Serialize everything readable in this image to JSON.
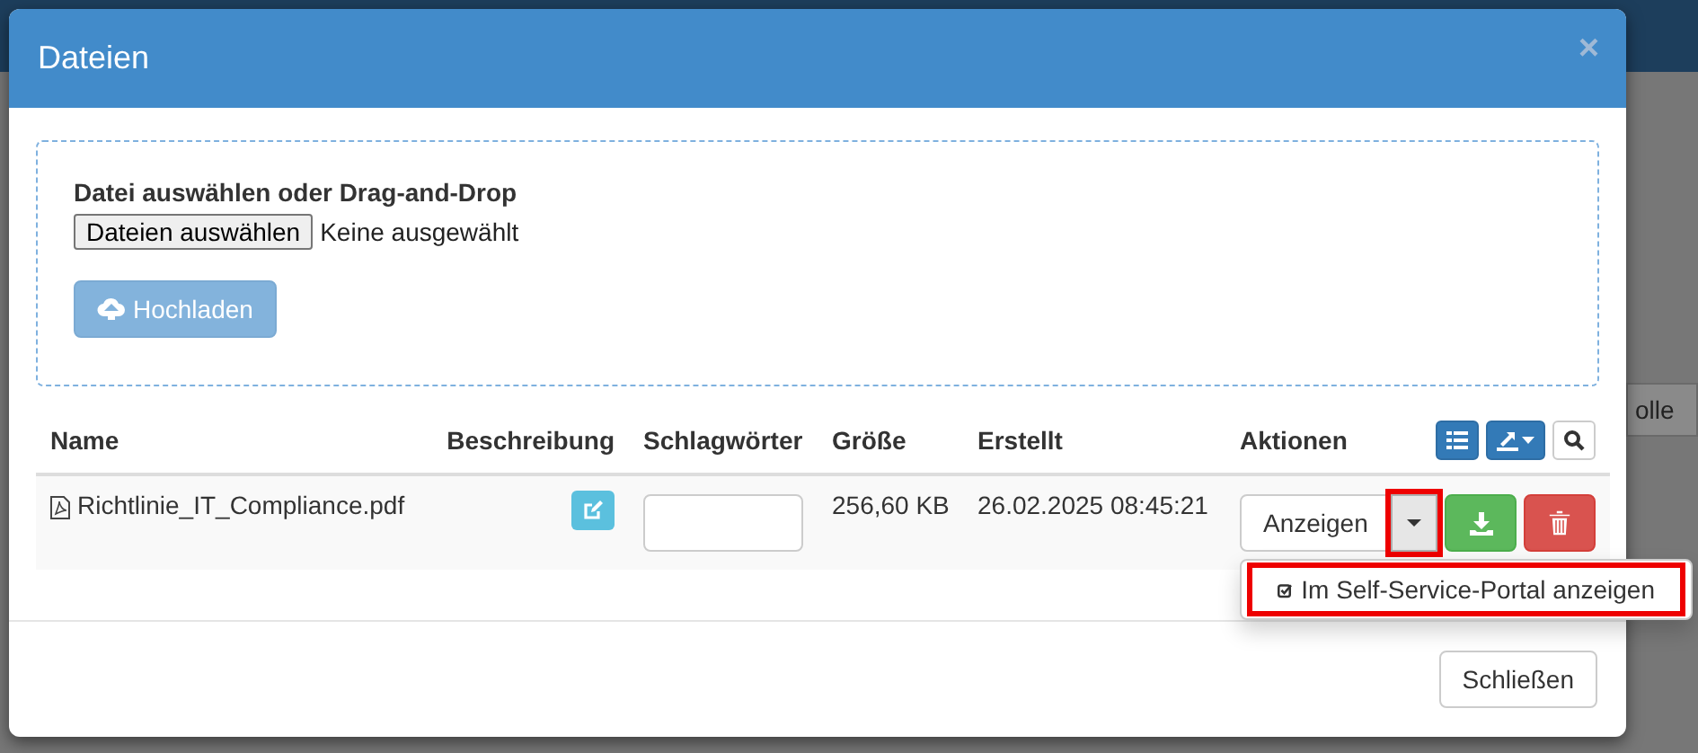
{
  "background": {
    "table_header_fragment": "olle"
  },
  "dialog": {
    "title": "Dateien",
    "close": "×",
    "upload": {
      "label": "Datei auswählen oder Drag-and-Drop",
      "file_button": "Dateien auswählen",
      "file_status": "Keine ausgewählt",
      "upload_button": "Hochladen",
      "upload_disabled": true
    },
    "table": {
      "columns": [
        "Name",
        "Beschreibung",
        "Schlagwörter",
        "Größe",
        "Erstellt",
        "Aktionen"
      ],
      "rows": [
        {
          "name": "Richtlinie_IT_Compliance.pdf",
          "size": "256,60 KB",
          "created": "26.02.2025 08:45:21",
          "action": "Anzeigen",
          "caret_highlighted": true
        }
      ]
    },
    "dropdown": {
      "open": true,
      "items": [
        {
          "label": "Im Self-Service-Portal anzeigen",
          "highlighted": true
        }
      ]
    },
    "footer_button": "Schließen"
  }
}
